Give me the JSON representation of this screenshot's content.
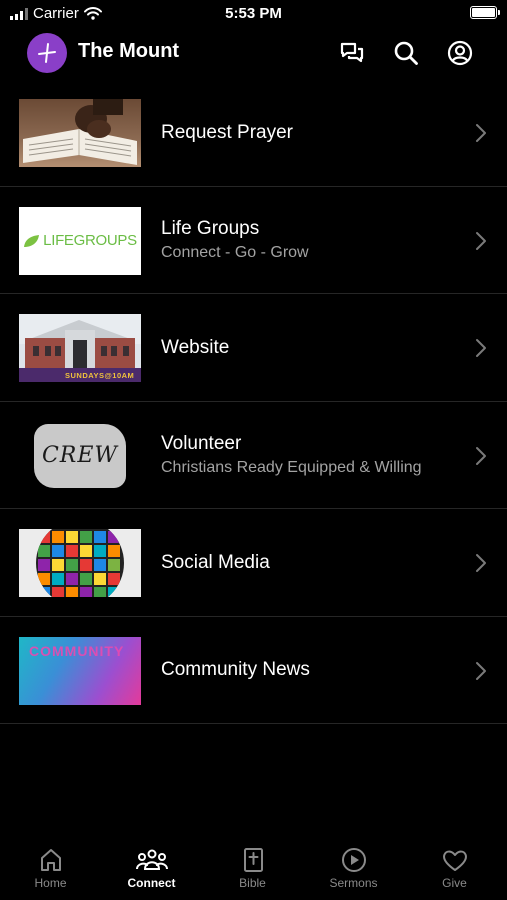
{
  "status_bar": {
    "carrier": "Carrier",
    "time": "5:53 PM"
  },
  "header": {
    "title": "The Mount",
    "icons": [
      "chat-icon",
      "search-icon",
      "account-icon"
    ]
  },
  "items": [
    {
      "title": "Request Prayer",
      "subtitle": ""
    },
    {
      "title": "Life Groups",
      "subtitle": "Connect - Go - Grow",
      "thumb_text": "LIFEGROUPS"
    },
    {
      "title": "Website",
      "subtitle": "",
      "thumb_text": "SUNDAYS@10AM"
    },
    {
      "title": "Volunteer",
      "subtitle": "Christians Ready Equipped & Willing",
      "thumb_text": "CREW"
    },
    {
      "title": "Social Media",
      "subtitle": ""
    },
    {
      "title": "Community News",
      "subtitle": "",
      "thumb_text": "COMMUNITY"
    }
  ],
  "tabs": [
    {
      "label": "Home",
      "icon": "home-icon"
    },
    {
      "label": "Connect",
      "icon": "people-icon",
      "active": true
    },
    {
      "label": "Bible",
      "icon": "bible-icon"
    },
    {
      "label": "Sermons",
      "icon": "play-icon"
    },
    {
      "label": "Give",
      "icon": "heart-icon"
    }
  ],
  "colors": {
    "background": "#000000",
    "accent": "#8a3fc8",
    "subtitle": "#a3a3a3",
    "tab_inactive": "#8a8a8a"
  }
}
